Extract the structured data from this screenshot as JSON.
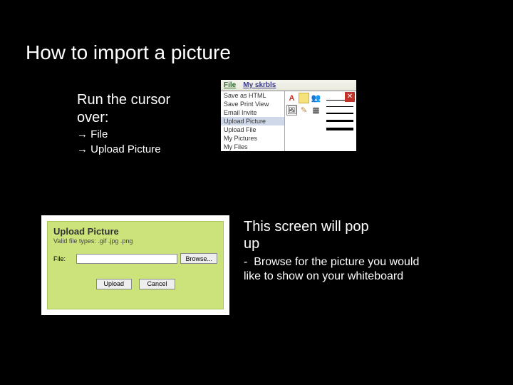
{
  "title": "How to import a picture",
  "section1": {
    "heading_l1": "Run the cursor",
    "heading_l2": "over:",
    "item1": "File",
    "item2": "Upload Picture",
    "arrow": "→"
  },
  "app": {
    "tab_file": "File",
    "tab_skrbls": "My skrbls",
    "menu": {
      "save_html": "Save as HTML",
      "save_print": "Save Print View",
      "email": "Email Invite",
      "upload_pic": "Upload Picture",
      "upload_file": "Upload File",
      "my_pics": "My Pictures",
      "my_files": "My Files"
    },
    "close": "✕"
  },
  "upload": {
    "title": "Upload Picture",
    "valid": "Valid file types: .gif .jpg .png",
    "file_label": "File:",
    "browse": "Browse...",
    "upload_btn": "Upload",
    "cancel_btn": "Cancel"
  },
  "section2": {
    "heading_l1": "This screen will pop",
    "heading_l2": "up",
    "dash": "-",
    "body": "Browse for the picture you would like to show on your whiteboard"
  }
}
